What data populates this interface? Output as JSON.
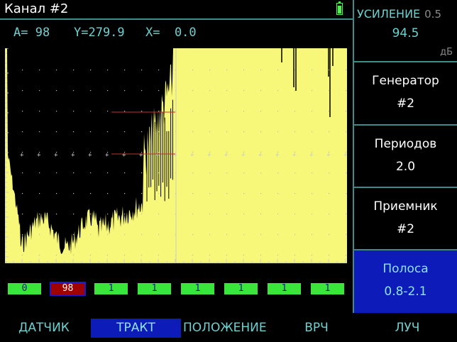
{
  "title": "Канал #2",
  "readout": {
    "a": "A= 98",
    "y": "Y=279.9",
    "x": "X=  0.0"
  },
  "panel": {
    "gain": {
      "label": "УСИЛЕНИЕ",
      "step": "0.5",
      "value": "94.5",
      "unit": "дБ"
    },
    "items": [
      {
        "label": "Генератор",
        "value": "#2"
      },
      {
        "label": "Периодов",
        "value": "2.0"
      },
      {
        "label": "Приемник",
        "value": "#2"
      },
      {
        "label": "Полоса",
        "value": "0.8-2.1"
      }
    ]
  },
  "gates": [
    "0",
    "98",
    "1",
    "1",
    "1",
    "1",
    "1",
    "1"
  ],
  "menu": [
    "ДАТЧИК",
    "ТРАКТ",
    "ПОЛОЖЕНИЕ",
    "ВРЧ",
    "ЛУЧ"
  ],
  "colors": {
    "signal_fill": "#f7f77a",
    "frame": "#3d8c8c",
    "active_bg": "#0d1bb8",
    "gate": "#39e639",
    "gate_alert": "#a00000",
    "text": "#6fd0d0"
  }
}
